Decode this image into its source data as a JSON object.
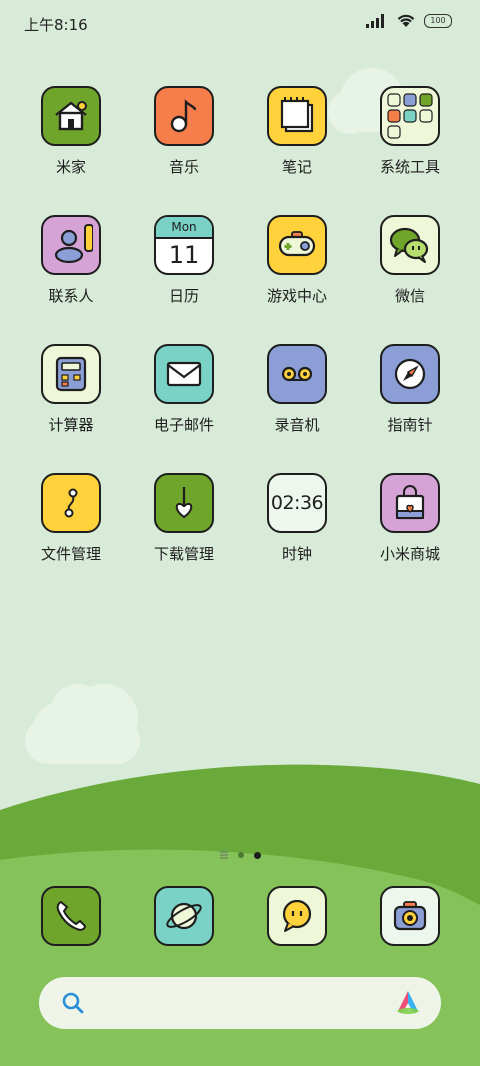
{
  "status_bar": {
    "time": "上午8:16",
    "battery": "100"
  },
  "apps": [
    {
      "label": "米家",
      "icon": "home-icon"
    },
    {
      "label": "音乐",
      "icon": "music-note-icon"
    },
    {
      "label": "笔记",
      "icon": "notepad-icon"
    },
    {
      "label": "系统工具",
      "icon": "folder-icon"
    },
    {
      "label": "联系人",
      "icon": "contact-icon"
    },
    {
      "label": "日历",
      "icon": "calendar-icon",
      "day": "Mon",
      "date": "11"
    },
    {
      "label": "游戏中心",
      "icon": "gamepad-icon"
    },
    {
      "label": "微信",
      "icon": "chat-bubbles-icon"
    },
    {
      "label": "计算器",
      "icon": "calculator-icon"
    },
    {
      "label": "电子邮件",
      "icon": "envelope-icon"
    },
    {
      "label": "录音机",
      "icon": "recorder-icon"
    },
    {
      "label": "指南针",
      "icon": "compass-icon"
    },
    {
      "label": "文件管理",
      "icon": "files-icon"
    },
    {
      "label": "下载管理",
      "icon": "download-icon"
    },
    {
      "label": "时钟",
      "icon": "clock-icon",
      "clock_time": "02:36"
    },
    {
      "label": "小米商城",
      "icon": "shopping-bag-icon"
    }
  ],
  "page_indicator": {
    "pages": 3,
    "current": 3
  },
  "dock": [
    {
      "name": "phone",
      "icon": "phone-icon"
    },
    {
      "name": "browser",
      "icon": "planet-icon"
    },
    {
      "name": "messages",
      "icon": "message-icon"
    },
    {
      "name": "camera",
      "icon": "camera-icon"
    }
  ],
  "colors": {
    "sky": "#d8ebd9",
    "hill_dark": "#6aaa3a",
    "hill_light": "#86c25a",
    "green_icon": "#6fa52a",
    "orange_icon": "#f57e4b",
    "yellow_icon": "#ffd23c",
    "cream_icon": "#eef7d8",
    "pink_icon": "#d6a3d6",
    "teal_icon": "#7ad1c6",
    "periwinkle_icon": "#8b9ed6"
  }
}
